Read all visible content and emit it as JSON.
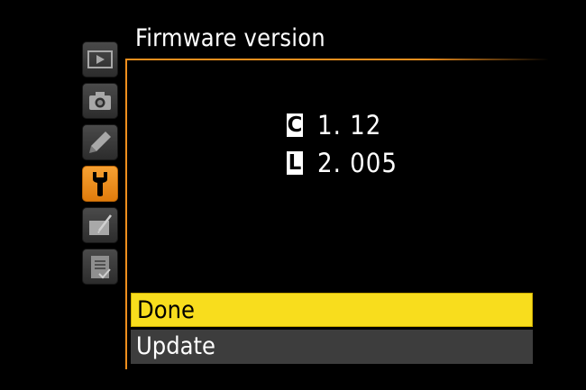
{
  "screen": {
    "title": "Firmware version"
  },
  "tabs": [
    {
      "icon": "playback-icon",
      "active": false
    },
    {
      "icon": "camera-icon",
      "active": false
    },
    {
      "icon": "pencil-icon",
      "active": false
    },
    {
      "icon": "wrench-icon",
      "active": true
    },
    {
      "icon": "retouch-icon",
      "active": false
    },
    {
      "icon": "recent-settings-icon",
      "active": false
    }
  ],
  "firmware": {
    "c_label": "C",
    "c_version": "1. 12",
    "l_label": "L",
    "l_version": "2. 005"
  },
  "menu": {
    "done_label": "Done",
    "update_label": "Update",
    "selected": "Done"
  },
  "colors": {
    "accent": "#f08f1d",
    "selected_item": "#f8dd1d",
    "unselected_item": "#3d3d3d",
    "background": "#000000"
  }
}
